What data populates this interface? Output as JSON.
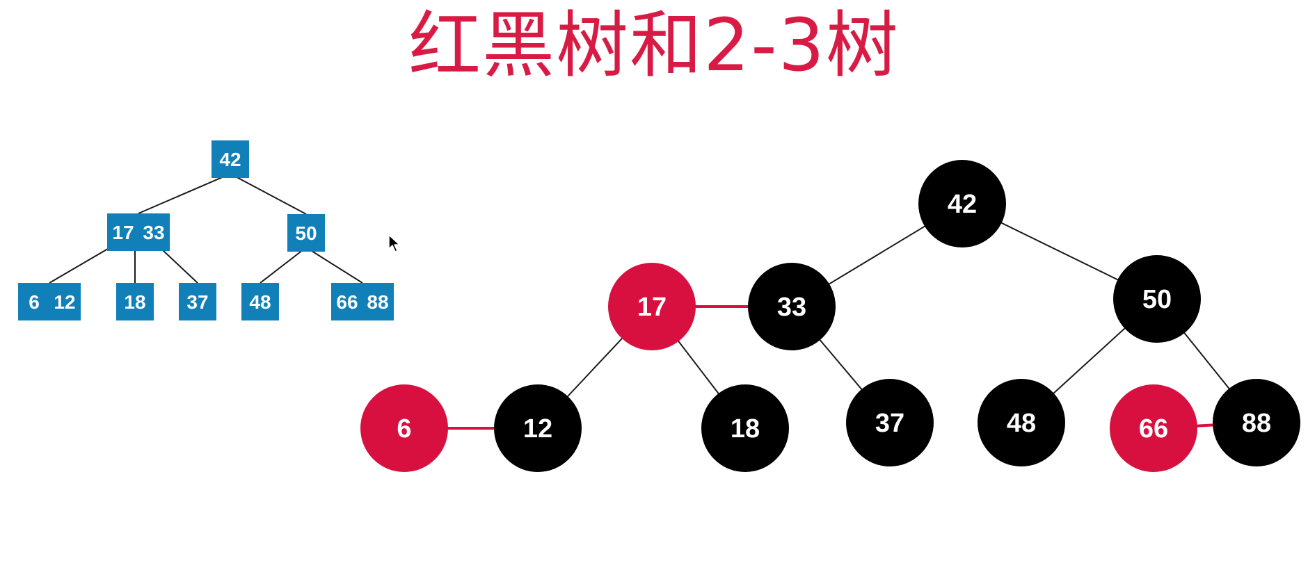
{
  "title": "红黑树和2-3树",
  "colors": {
    "title": "#d81b44",
    "red_node": "#d8103f",
    "black_node": "#000000",
    "tt_node": "#117fb8",
    "edge": "#1a1a1a",
    "red_link": "#d8103f",
    "node_text": "#ffffff"
  },
  "two_three_tree": {
    "nodes": [
      {
        "id": "n42",
        "keys": [
          "42"
        ]
      },
      {
        "id": "n17_33",
        "keys": [
          "17",
          "33"
        ]
      },
      {
        "id": "n50",
        "keys": [
          "50"
        ]
      },
      {
        "id": "n6_12",
        "keys": [
          "6",
          "12"
        ]
      },
      {
        "id": "n18",
        "keys": [
          "18"
        ]
      },
      {
        "id": "n37",
        "keys": [
          "37"
        ]
      },
      {
        "id": "n48",
        "keys": [
          "48"
        ]
      },
      {
        "id": "n66_88",
        "keys": [
          "66",
          "88"
        ]
      }
    ],
    "edges": [
      [
        "n42",
        "n17_33"
      ],
      [
        "n42",
        "n50"
      ],
      [
        "n17_33",
        "n6_12"
      ],
      [
        "n17_33",
        "n18"
      ],
      [
        "n17_33",
        "n37"
      ],
      [
        "n50",
        "n48"
      ],
      [
        "n50",
        "n66_88"
      ]
    ]
  },
  "red_black_tree": {
    "nodes": [
      {
        "key": "42",
        "color": "black"
      },
      {
        "key": "17",
        "color": "red"
      },
      {
        "key": "33",
        "color": "black"
      },
      {
        "key": "50",
        "color": "black"
      },
      {
        "key": "6",
        "color": "red"
      },
      {
        "key": "12",
        "color": "black"
      },
      {
        "key": "18",
        "color": "black"
      },
      {
        "key": "37",
        "color": "black"
      },
      {
        "key": "48",
        "color": "black"
      },
      {
        "key": "66",
        "color": "red"
      },
      {
        "key": "88",
        "color": "black"
      }
    ],
    "edges": [
      {
        "from": "42",
        "to": "33",
        "red": false
      },
      {
        "from": "42",
        "to": "50",
        "red": false
      },
      {
        "from": "17",
        "to": "33",
        "red": true
      },
      {
        "from": "17",
        "to": "12",
        "red": false
      },
      {
        "from": "17",
        "to": "18",
        "red": false
      },
      {
        "from": "33",
        "to": "37",
        "red": false
      },
      {
        "from": "50",
        "to": "48",
        "red": false
      },
      {
        "from": "50",
        "to": "88",
        "red": false
      },
      {
        "from": "6",
        "to": "12",
        "red": true
      },
      {
        "from": "66",
        "to": "88",
        "red": true
      }
    ]
  }
}
